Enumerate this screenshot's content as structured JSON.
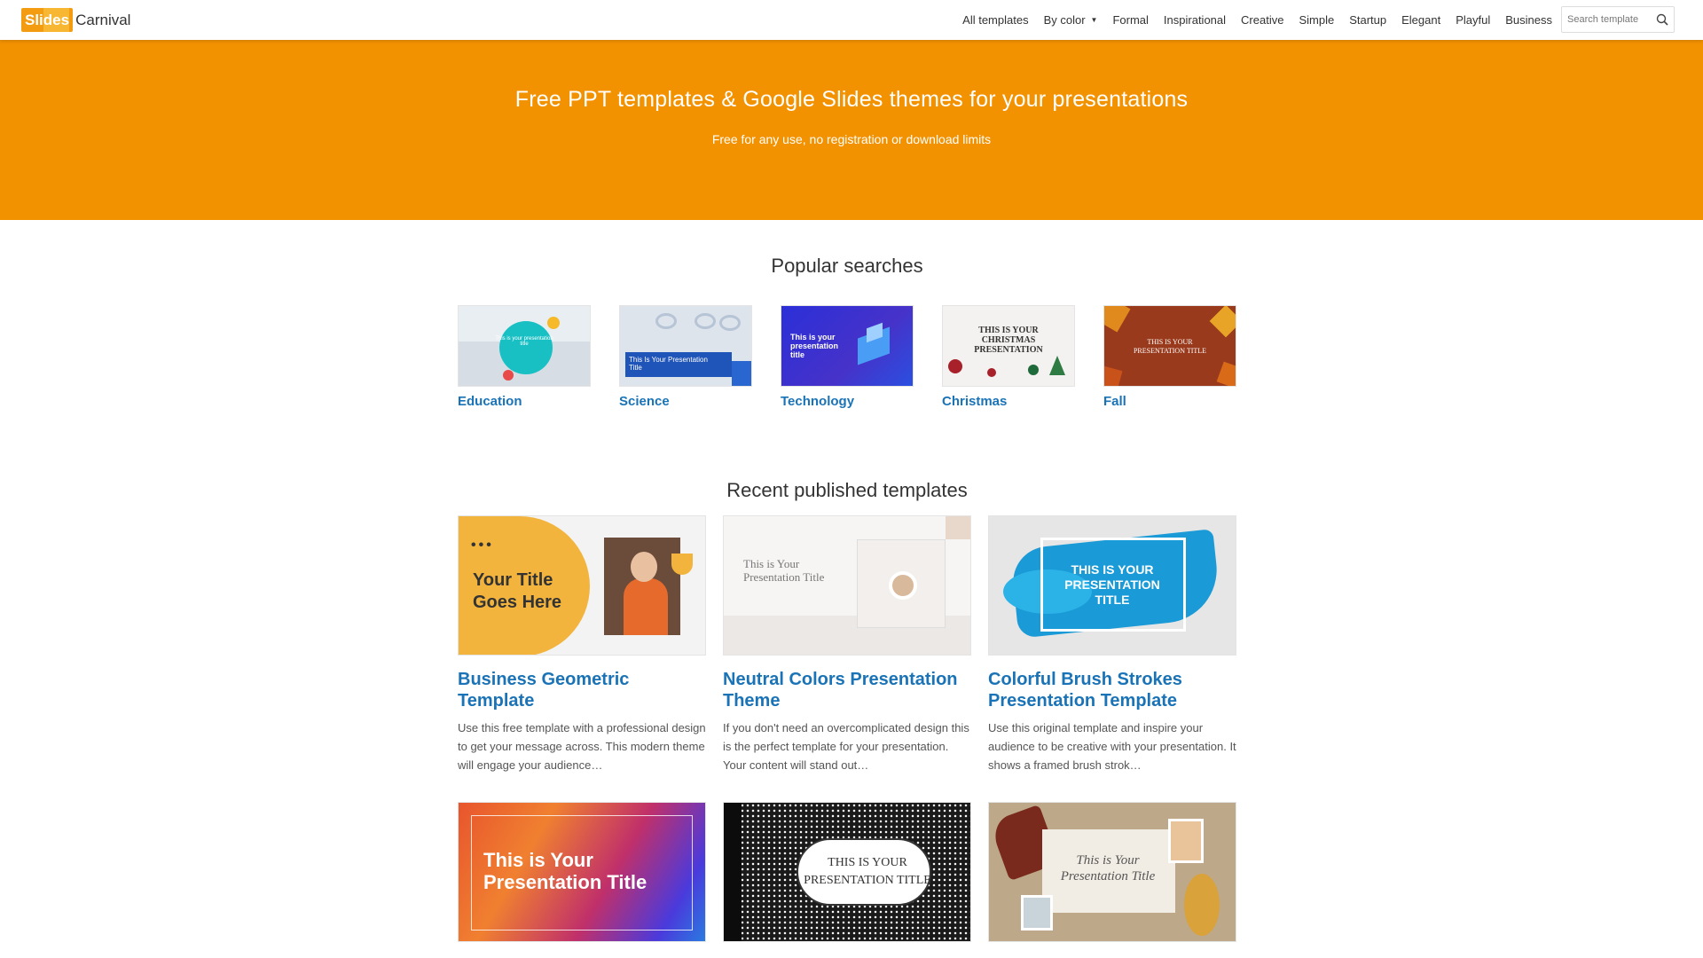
{
  "brand": {
    "logo_part1": "Sli",
    "logo_part2": "des",
    "logo_text": "Carnival"
  },
  "nav": {
    "items": [
      "All templates",
      "By color",
      "Formal",
      "Inspirational",
      "Creative",
      "Simple",
      "Startup",
      "Elegant",
      "Playful",
      "Business"
    ],
    "search_placeholder": "Search template"
  },
  "hero": {
    "title": "Free PPT templates & Google Slides themes for your presentations",
    "subtitle": "Free for any use, no registration or download limits"
  },
  "popular": {
    "heading": "Popular searches",
    "items": [
      {
        "label": "Education",
        "thumb_text": "This is your presentation title"
      },
      {
        "label": "Science",
        "thumb_text": "This Is Your Presentation Title"
      },
      {
        "label": "Technology",
        "thumb_text": "This is your presentation title"
      },
      {
        "label": "Christmas",
        "thumb_text": "THIS IS YOUR CHRISTMAS PRESENTATION"
      },
      {
        "label": "Fall",
        "thumb_text": "THIS IS YOUR PRESENTATION TITLE"
      }
    ]
  },
  "recent": {
    "heading": "Recent published templates",
    "cards": [
      {
        "title": "Business Geometric Template",
        "thumb_text": "Your Title Goes Here",
        "desc": "Use this free template with a professional design to get your message across. This modern theme will engage your audience…"
      },
      {
        "title": "Neutral Colors Presentation Theme",
        "thumb_text": "This is Your Presentation Title",
        "desc": "If you don't need an overcomplicated design this is the perfect template for your presentation. Your content will stand out…"
      },
      {
        "title": "Colorful Brush Strokes Presentation Template",
        "thumb_text": "THIS IS YOUR PRESENTATION TITLE",
        "desc": "Use this original template and inspire your audience to be creative with your presentation. It shows a framed brush strok…"
      },
      {
        "thumb_text": "This is Your Presentation Title"
      },
      {
        "thumb_text": "THIS IS YOUR PRESENTATION TITLE"
      },
      {
        "thumb_text": "This is Your Presentation Title"
      }
    ]
  },
  "colors": {
    "accent": "#f39200",
    "link": "#1a73b6"
  }
}
